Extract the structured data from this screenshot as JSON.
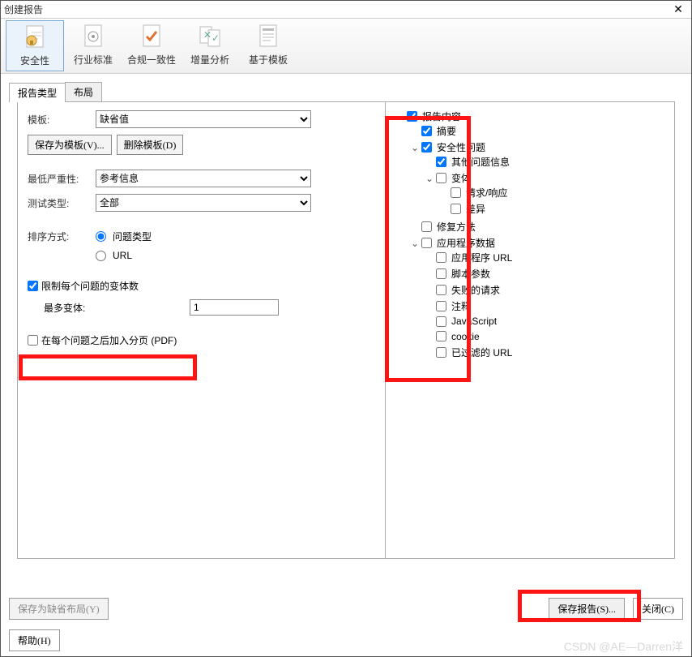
{
  "window": {
    "title": "创建报告"
  },
  "toolbar": {
    "items": [
      {
        "label": "安全性",
        "selected": true
      },
      {
        "label": "行业标准"
      },
      {
        "label": "合规一致性"
      },
      {
        "label": "增量分析"
      },
      {
        "label": "基于模板"
      }
    ]
  },
  "tabs": {
    "items": [
      {
        "label": "报告类型",
        "active": true
      },
      {
        "label": "布局"
      }
    ]
  },
  "form": {
    "template_label": "模板:",
    "template_value": "缺省值",
    "save_template_btn": "保存为模板(V)...",
    "delete_template_btn": "删除模板(D)",
    "severity_label": "最低严重性:",
    "severity_value": "参考信息",
    "test_type_label": "测试类型:",
    "test_type_value": "全部",
    "sort_label": "排序方式:",
    "sort_options": {
      "issue_type": "问题类型",
      "url": "URL"
    },
    "sort_selected": "issue_type",
    "limit_variants_label": "限制每个问题的变体数",
    "limit_variants_checked": true,
    "max_variants_label": "最多变体:",
    "max_variants_value": "1",
    "pdf_pagebreak_label": "在每个问题之后加入分页 (PDF)",
    "pdf_pagebreak_checked": false
  },
  "tree": {
    "root": {
      "label": "报告内容",
      "checked": true,
      "expanded": true,
      "children": [
        {
          "label": "摘要",
          "checked": true
        },
        {
          "label": "安全性问题",
          "checked": true,
          "expanded": true,
          "children": [
            {
              "label": "其他问题信息",
              "checked": true
            },
            {
              "label": "变体",
              "checked": false,
              "expanded": true,
              "children": [
                {
                  "label": "请求/响应",
                  "checked": false
                },
                {
                  "label": "差异",
                  "checked": false
                }
              ]
            }
          ]
        },
        {
          "label": "修复方法",
          "checked": false
        },
        {
          "label": "应用程序数据",
          "checked": false,
          "expanded": true,
          "children": [
            {
              "label": "应用程序 URL",
              "checked": false
            },
            {
              "label": "脚本参数",
              "checked": false
            },
            {
              "label": "失败的请求",
              "checked": false
            },
            {
              "label": "注释",
              "checked": false
            },
            {
              "label": "JavaScript",
              "checked": false
            },
            {
              "label": "cookie",
              "checked": false
            },
            {
              "label": "已过滤的 URL",
              "checked": false
            }
          ]
        }
      ]
    }
  },
  "footer": {
    "save_layout_btn": "保存为缺省布局(Y)",
    "save_report_btn": "保存报告(S)...",
    "close_btn": "关闭(C)",
    "help_btn": "帮助(H)"
  },
  "watermark": "CSDN @AE—Darren洋"
}
